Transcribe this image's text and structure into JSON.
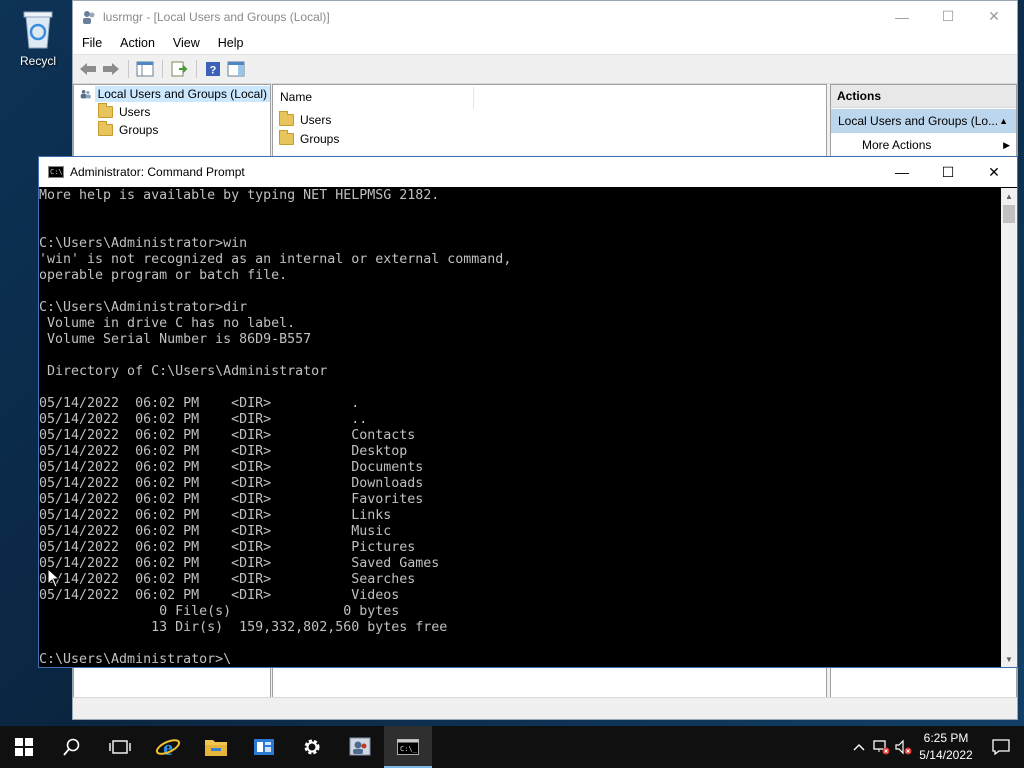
{
  "desktop": {
    "recycle_label": "Recycl"
  },
  "mmc": {
    "title": "lusrmgr - [Local Users and Groups (Local)]",
    "menu": [
      "File",
      "Action",
      "View",
      "Help"
    ],
    "tree": {
      "root": "Local Users and Groups (Local)",
      "children": [
        "Users",
        "Groups"
      ]
    },
    "list": {
      "header": "Name",
      "rows": [
        "Users",
        "Groups"
      ]
    },
    "actions": {
      "header": "Actions",
      "section": "Local Users and Groups (Lo...",
      "more": "More Actions"
    }
  },
  "cmd": {
    "title": "Administrator: Command Prompt",
    "lines": [
      "More help is available by typing NET HELPMSG 2182.",
      "",
      "",
      "C:\\Users\\Administrator>win",
      "'win' is not recognized as an internal or external command,",
      "operable program or batch file.",
      "",
      "C:\\Users\\Administrator>dir",
      " Volume in drive C has no label.",
      " Volume Serial Number is 86D9-B557",
      "",
      " Directory of C:\\Users\\Administrator",
      "",
      "05/14/2022  06:02 PM    <DIR>          .",
      "05/14/2022  06:02 PM    <DIR>          ..",
      "05/14/2022  06:02 PM    <DIR>          Contacts",
      "05/14/2022  06:02 PM    <DIR>          Desktop",
      "05/14/2022  06:02 PM    <DIR>          Documents",
      "05/14/2022  06:02 PM    <DIR>          Downloads",
      "05/14/2022  06:02 PM    <DIR>          Favorites",
      "05/14/2022  06:02 PM    <DIR>          Links",
      "05/14/2022  06:02 PM    <DIR>          Music",
      "05/14/2022  06:02 PM    <DIR>          Pictures",
      "05/14/2022  06:02 PM    <DIR>          Saved Games",
      "05/14/2022  06:02 PM    <DIR>          Searches",
      "05/14/2022  06:02 PM    <DIR>          Videos",
      "               0 File(s)              0 bytes",
      "              13 Dir(s)  159,332,802,560 bytes free",
      "",
      "C:\\Users\\Administrator>\\"
    ]
  },
  "taskbar": {
    "icons": [
      "windows-start-icon",
      "search-icon",
      "task-view-icon",
      "internet-explorer-icon",
      "file-explorer-icon",
      "server-manager-icon",
      "settings-gear-icon",
      "lusrmgr-icon",
      "command-prompt-icon"
    ],
    "time": "6:25 PM",
    "date": "5/14/2022"
  },
  "colors": {
    "accent": "#3d6fb2",
    "selection": "#cce8ff",
    "taskbar": "#101010",
    "console_text": "#c0c0c0"
  }
}
